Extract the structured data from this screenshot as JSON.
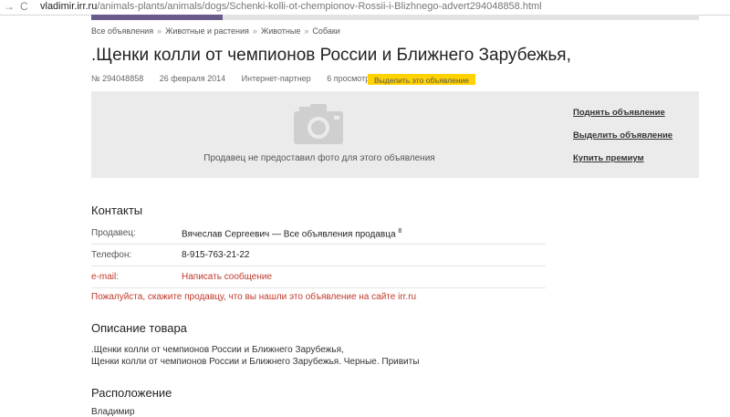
{
  "browser": {
    "url_host": "vladimir.irr.ru",
    "url_path": "/animals-plants/animals/dogs/Schenki-kolli-ot-chempionov-Rossii-i-Blizhnego-advert294048858.html"
  },
  "breadcrumbs": [
    "Все объявления",
    "Животные и растения",
    "Животные",
    "Собаки"
  ],
  "ad": {
    "title": ".Щенки колли от чемпионов России и Ближнего Зарубежья,",
    "number": "№ 294048858",
    "date": "26 февраля 2014",
    "partner": "Интернет-партнер",
    "views": "6 просмотров",
    "highlight_button": "Выделить это объявление"
  },
  "photo": {
    "no_photo_text": "Продавец не предоставил фото для этого объявления",
    "camera_icon": "camera-icon",
    "links": [
      "Поднять объявление",
      "Выделить объявление",
      "Купить премиум"
    ]
  },
  "contacts": {
    "heading": "Контакты",
    "seller_label": "Продавец:",
    "seller_value": "Вячеслав Сергеевич — Все объявления продавца",
    "seller_count": "8",
    "phone_label": "Телефон:",
    "phone_value": "8-915-763-21-22",
    "email_label": "e-mail:",
    "email_value": "Написать сообщение",
    "notice": "Пожалуйста, скажите продавцу, что вы нашли это объявление на сайте irr.ru"
  },
  "description": {
    "heading": "Описание товара",
    "line1": ".Щенки колли от чемпионов России и Ближнего Зарубежья,",
    "line2": "Щенки колли от чемпионов России и Ближнего Зарубежья. Черные. Привиты"
  },
  "location": {
    "heading": "Расположение",
    "city": "Владимир"
  },
  "colors": {
    "accent_yellow": "#ffd200",
    "link_red": "#c0392b",
    "tab_purple": "#6b5b8a",
    "panel_grey": "#ebebeb"
  }
}
